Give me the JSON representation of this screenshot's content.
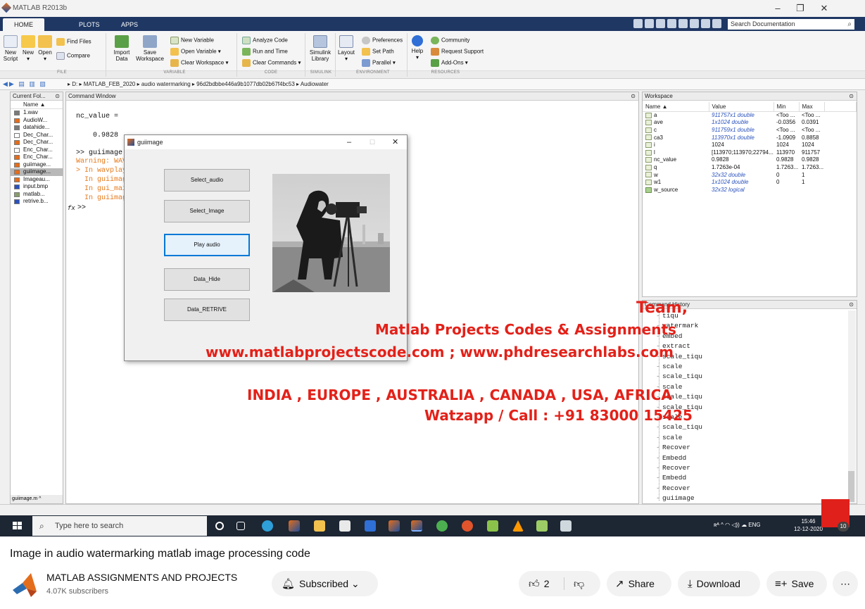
{
  "app": {
    "window_title": "MATLAB R2013b",
    "tabs": [
      "HOME",
      "PLOTS",
      "APPS"
    ],
    "search_placeholder": "Search Documentation",
    "ribbon": {
      "new_script": "New\nScript",
      "new": "New",
      "open": "Open",
      "find_files": "Find Files",
      "compare": "Compare",
      "import_data": "Import\nData",
      "save_workspace": "Save\nWorkspace",
      "new_variable": "New Variable",
      "open_variable": "Open Variable",
      "clear_workspace": "Clear Workspace",
      "analyze_code": "Analyze Code",
      "run_and_time": "Run and Time",
      "clear_commands": "Clear Commands",
      "simulink_library": "Simulink\nLibrary",
      "layout": "Layout",
      "preferences": "Preferences",
      "set_path": "Set Path",
      "parallel": "Parallel",
      "help": "Help",
      "community": "Community",
      "request_support": "Request Support",
      "add_ons": "Add-Ons",
      "groups": [
        "FILE",
        "VARIABLE",
        "CODE",
        "SIMULINK",
        "ENVIRONMENT",
        "RESOURCES"
      ]
    },
    "address_path": "▸ D: ▸ MATLAB_FEB_2020 ▸ audio watermarking ▸ 96d2bdbbe446a9b1077db02b67f4bc53 ▸ Audiowater",
    "current_folder": {
      "title": "Current Fol...",
      "name_header": "Name ▲",
      "files": [
        "1.wav",
        "AudioW...",
        "datahide...",
        "Dec_Char...",
        "Dec_Char...",
        "Enc_Char...",
        "Enc_Char...",
        "guiimage...",
        "guiimage...",
        "Imageau...",
        "input.bmp",
        "matlab...",
        "retrive.b..."
      ],
      "selected_index": 8,
      "footer": "guiimage.m"
    },
    "command_window": {
      "title": "Command Window",
      "lines": {
        "l1": "nc_value =",
        "l2": "0.9828",
        "l3": ">> guiimage",
        "l4": "Warning: WAV",
        "l5": "> In wavplay",
        "l6": "In guiimag",
        "l7": "In gui_mai",
        "l8": "In guiimag",
        "prompt": ">>",
        "fx": "fx"
      }
    },
    "workspace": {
      "title": "Workspace",
      "columns": [
        "Name ▲",
        "Value",
        "Min",
        "Max"
      ],
      "rows": [
        {
          "name": "a",
          "value": "911757x1 double",
          "min": "<Too ...",
          "max": "<Too ...",
          "italic": true
        },
        {
          "name": "ave",
          "value": "1x1024 double",
          "min": "-0.0356",
          "max": "0.0391",
          "italic": true
        },
        {
          "name": "c",
          "value": "911759x1 double",
          "min": "<Too ...",
          "max": "<Too ...",
          "italic": true
        },
        {
          "name": "ca3",
          "value": "113970x1 double",
          "min": "-1.0909",
          "max": "0.8858",
          "italic": true
        },
        {
          "name": "i",
          "value": "1024",
          "min": "1024",
          "max": "1024",
          "italic": false
        },
        {
          "name": "l",
          "value": "[113970;113970;22794...",
          "min": "113970",
          "max": "911757",
          "italic": false
        },
        {
          "name": "nc_value",
          "value": "0.9828",
          "min": "0.9828",
          "max": "0.9828",
          "italic": false
        },
        {
          "name": "q",
          "value": "1.7263e-04",
          "min": "1.7263...",
          "max": "1.7263...",
          "italic": false
        },
        {
          "name": "w",
          "value": "32x32 double",
          "min": "0",
          "max": "1",
          "italic": true
        },
        {
          "name": "w1",
          "value": "1x1024 double",
          "min": "0",
          "max": "1",
          "italic": true
        },
        {
          "name": "w_source",
          "value": "32x32 logical",
          "min": "",
          "max": "",
          "italic": true
        }
      ]
    },
    "command_history": {
      "title": "Command History",
      "items": [
        "tiqu",
        "watermark",
        "embed",
        "extract",
        "scale_tiqu",
        "scale",
        "scale_tiqu",
        "scale",
        "scale_tiqu",
        "scale_tiqu",
        "scale",
        "scale_tiqu",
        "scale",
        "Recover",
        "Embedd",
        "Recover",
        "Embedd",
        "Recover",
        "guiimage"
      ]
    }
  },
  "gui_window": {
    "title": "guiimage",
    "buttons": [
      "Select_audio",
      "Select_Image",
      "Play audio",
      "Data_Hide",
      "Data_RETRIVE"
    ],
    "focused_index": 2
  },
  "watermark": {
    "team": "Team,",
    "line1": "Matlab Projects Codes & Assignments",
    "line2": "www.matlabprojectscode.com ; www.phdresearchlabs.com",
    "line3": "INDIA , EUROPE , AUSTRALIA , CANADA , USA, AFRICA",
    "line4": "Watzapp / Call : +91 83000 15425"
  },
  "taskbar": {
    "search_placeholder": "Type here to search",
    "lang": "ENG",
    "time": "15:46",
    "date": "12-12-2020",
    "notifications": "10"
  },
  "youtube": {
    "video_title": "Image in audio watermarking matlab image processing code",
    "channel_name": "MATLAB ASSIGNMENTS AND PROJECTS",
    "subscribers": "4.07K subscribers",
    "subscribed_label": "Subscribed",
    "likes": "2",
    "share_label": "Share",
    "download_label": "Download",
    "save_label": "Save"
  },
  "colors": {
    "matlab_tabbar": "#1f3763",
    "watermark_red": "#e32119",
    "taskbar": "#1d2633"
  }
}
